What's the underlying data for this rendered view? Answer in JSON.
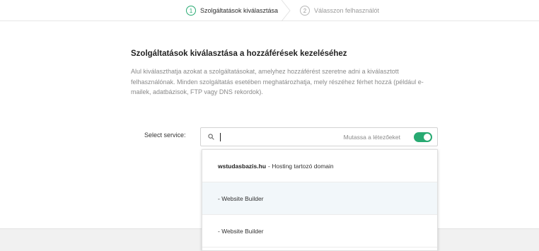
{
  "stepper": {
    "steps": [
      {
        "number": "1",
        "label": "Szolgáltatások kiválasztása",
        "state": "active"
      },
      {
        "number": "2",
        "label": "Válasszon felhasználót",
        "state": "inactive"
      }
    ]
  },
  "content": {
    "title": "Szolgáltatások kiválasztása a hozzáférések kezeléséhez",
    "description": "Alul kiválaszthatja azokat a szolgáltatásokat, amelyhez hozzáférést szeretne adni a kiválasztott felhasználónak. Minden szolgáltatás esetében meghatározhatja, mely részéhez férhet hozzá (például e-mailek, adatbázisok, FTP vagy DNS rekordok)."
  },
  "select_service": {
    "label": "Select service:",
    "search_value": "",
    "toggle_label": "Mutassa a létezőeket",
    "toggle_on": true,
    "search_icon": "search-icon"
  },
  "dropdown": {
    "items": [
      {
        "bold": "wstudasbazis.hu",
        "text": " - Hosting tartozó domain"
      },
      {
        "bold": "",
        "text": "- Website Builder"
      },
      {
        "bold": "",
        "text": "- Website Builder"
      }
    ]
  },
  "colors": {
    "accent": "#28aa72",
    "hover_row": "#f2f7fa",
    "footer": "#f1f1f1"
  }
}
